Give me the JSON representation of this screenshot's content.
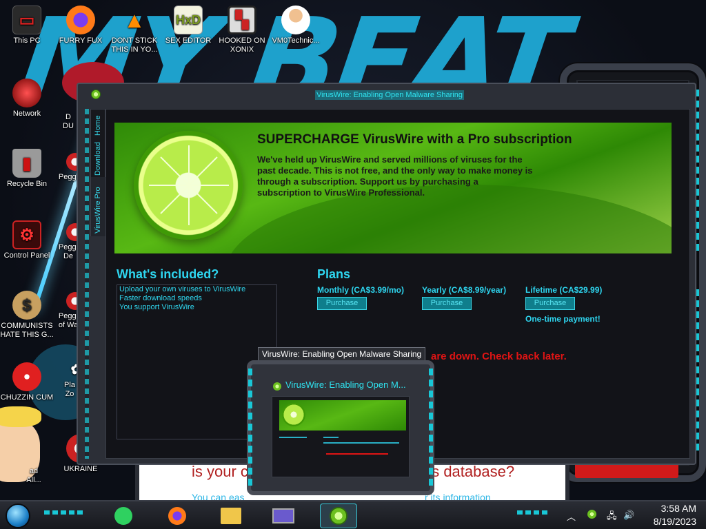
{
  "window": {
    "title": "VirusWire: Enabling Open Malware Sharing",
    "tabs": [
      "Home",
      "Download",
      "VirusWire Pro"
    ]
  },
  "banner": {
    "title": "SUPERCHARGE VirusWire with a Pro subscription",
    "description": "We've held up VirusWire and served millions of viruses for the past decade. This is not free, and the only way to make money is through a subscription. Support us by purchasing a subscription to VirusWire Professional."
  },
  "included": {
    "title": "What's included?",
    "items": [
      "Upload your own viruses to VirusWire",
      "Faster download speeds",
      "You support VirusWire"
    ]
  },
  "plans": {
    "title": "Plans",
    "items": [
      {
        "name": "Monthly (CA$3.99/mo)",
        "button": "Purchase"
      },
      {
        "name": "Yearly (CA$8.99/year)",
        "button": "Purchase"
      },
      {
        "name": "Lifetime (CA$29.99)",
        "button": "Purchase",
        "note": "One-time payment!"
      }
    ]
  },
  "status_message": "are down. Check back later.",
  "preview": {
    "tooltip": "VirusWire: Enabling Open Malware Sharing",
    "title": "VirusWire: Enabling Open M..."
  },
  "background_page": {
    "heading_left": "is your c",
    "heading_right": "'s database?",
    "text_left": "You can eas",
    "text_right": "r its information"
  },
  "desktop_icons": [
    {
      "label": "This PC"
    },
    {
      "label": "FURRY FUX"
    },
    {
      "label": "DONT STICK THIS IN YO..."
    },
    {
      "label": "SEX EDITOR"
    },
    {
      "label": "HOOKED ON XONIX"
    },
    {
      "label": "VM0Technic..."
    },
    {
      "label": "Network"
    },
    {
      "label": "Recycle Bin"
    },
    {
      "label": "Control Panel"
    },
    {
      "label": "COMMUNISTS HATE THIS G..."
    },
    {
      "label": "CHUZZIN CUM"
    },
    {
      "label": "UKRAINE"
    }
  ],
  "partial_labels": {
    "l1": "D",
    "l2": "DU",
    "l3": "Peggl",
    "l4": "Peggl",
    "l5": "De",
    "l6": "Peggl",
    "l7": "of Wa",
    "l8": "Pla",
    "l9": "Zo",
    "l10": "ad",
    "l11": "All..."
  },
  "taskbar": {
    "time": "3:58 AM",
    "date": "8/19/2023"
  },
  "colors": {
    "accent_cyan": "#2ed6f0",
    "lime_green": "#58b814",
    "alert_red": "#e01414"
  }
}
